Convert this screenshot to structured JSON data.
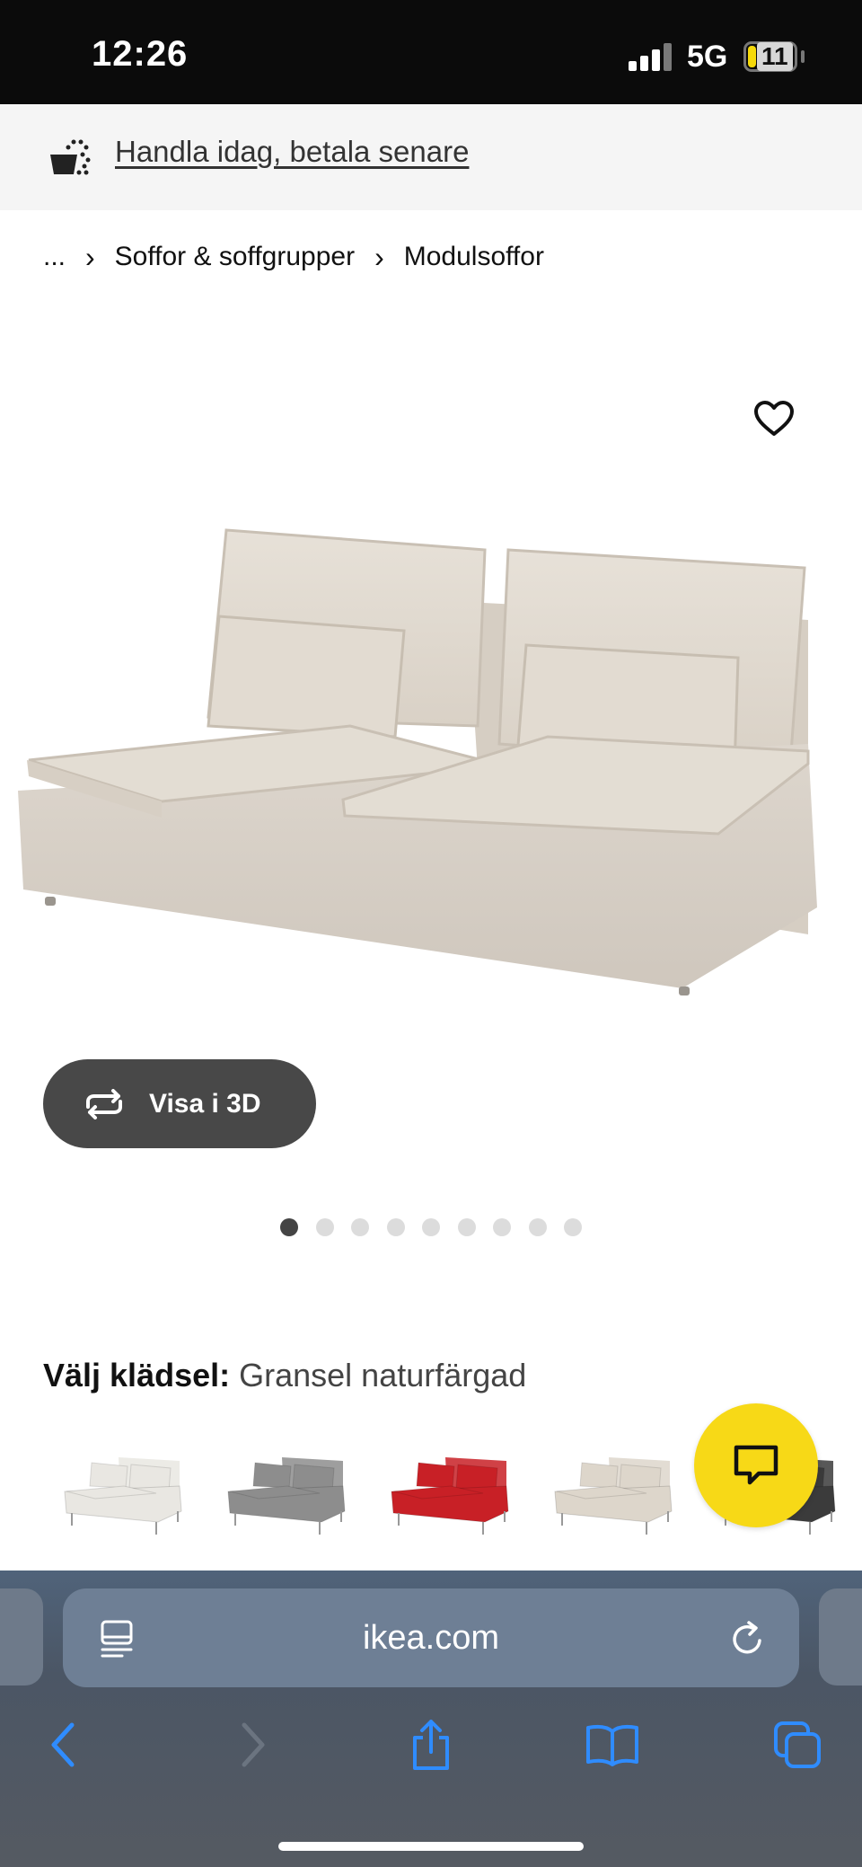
{
  "status_bar": {
    "time": "12:26",
    "network": "5G",
    "battery": "11",
    "battery_color": "#f5d90a"
  },
  "promo": {
    "icon": "shopping-bag-icon",
    "link_text": "Handla idag, betala senare"
  },
  "breadcrumb": {
    "items": [
      "...",
      "Soffor & soffgrupper",
      "Modulsoffor"
    ],
    "separator": "›"
  },
  "product": {
    "image": "sofa-section-image",
    "favorite_icon": "heart-icon",
    "view_3d_label": "Visa i 3D",
    "gallery": {
      "total_images": 9,
      "active_index": 0
    }
  },
  "fabric": {
    "label": "Välj klädsel:",
    "value": "Gransel naturfärgad",
    "options": [
      {
        "name": "white",
        "color": "#e9e7e2"
      },
      {
        "name": "grey",
        "color": "#8d8d8d"
      },
      {
        "name": "red",
        "color": "#c82026"
      },
      {
        "name": "beige",
        "color": "#ddd6cb"
      },
      {
        "name": "dark",
        "color": "#3b3b3b"
      }
    ]
  },
  "chat": {
    "icon": "chat-bubble-icon",
    "color": "#f7d917"
  },
  "browser": {
    "url": "ikea.com",
    "reader_icon": "reader-mode-icon",
    "reload_icon": "reload-icon",
    "nav": [
      "back-icon",
      "forward-icon",
      "share-icon",
      "bookmarks-icon",
      "tabs-icon"
    ]
  }
}
